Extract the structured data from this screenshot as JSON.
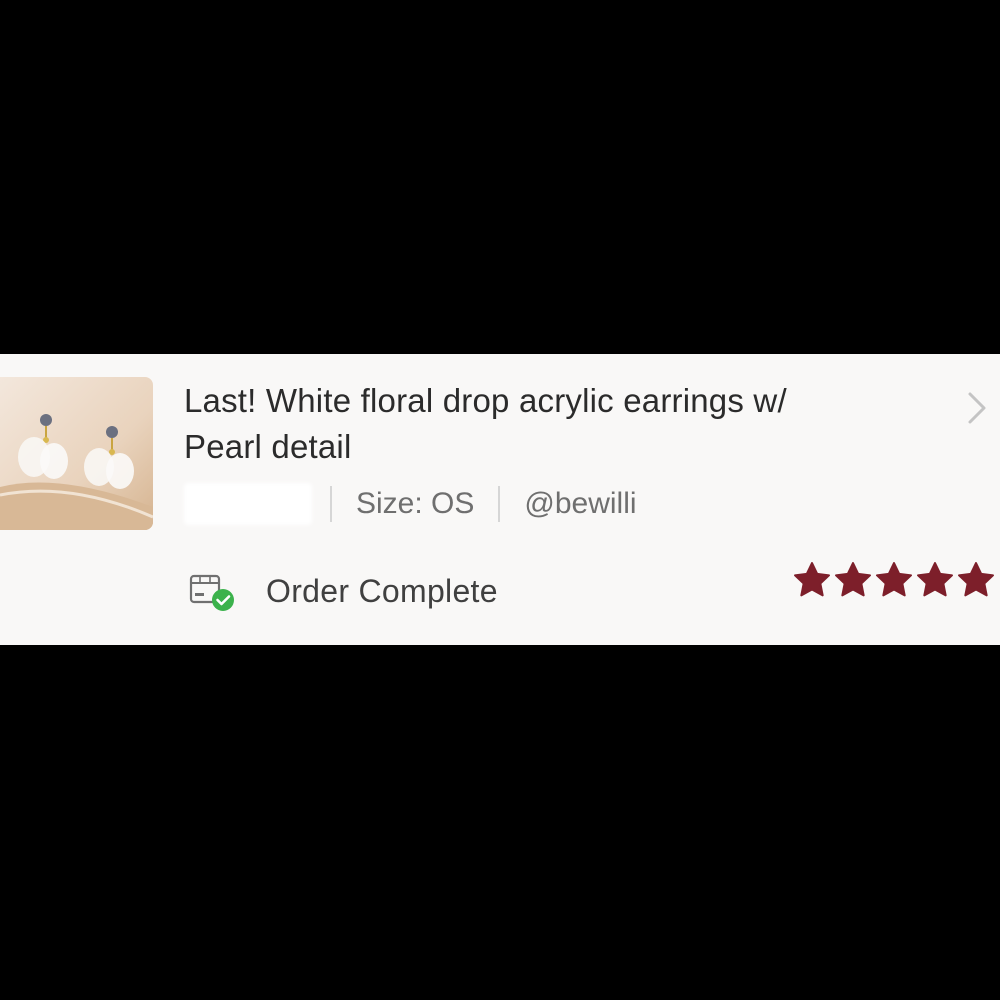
{
  "order": {
    "title_line1": "Last! White floral drop acrylic earrings w/",
    "title_line2": "Pearl detail",
    "size": "Size: OS",
    "seller": "@bewilli",
    "status": "Order Complete",
    "rating": 5,
    "rating_max": 5
  },
  "icons": {
    "status": "package-check-icon",
    "chevron": "chevron-right-icon",
    "star": "star-icon"
  },
  "colors": {
    "star": "#7d1f2a",
    "check": "#3cb24c",
    "background": "#000000",
    "card": "#f9f8f7"
  }
}
